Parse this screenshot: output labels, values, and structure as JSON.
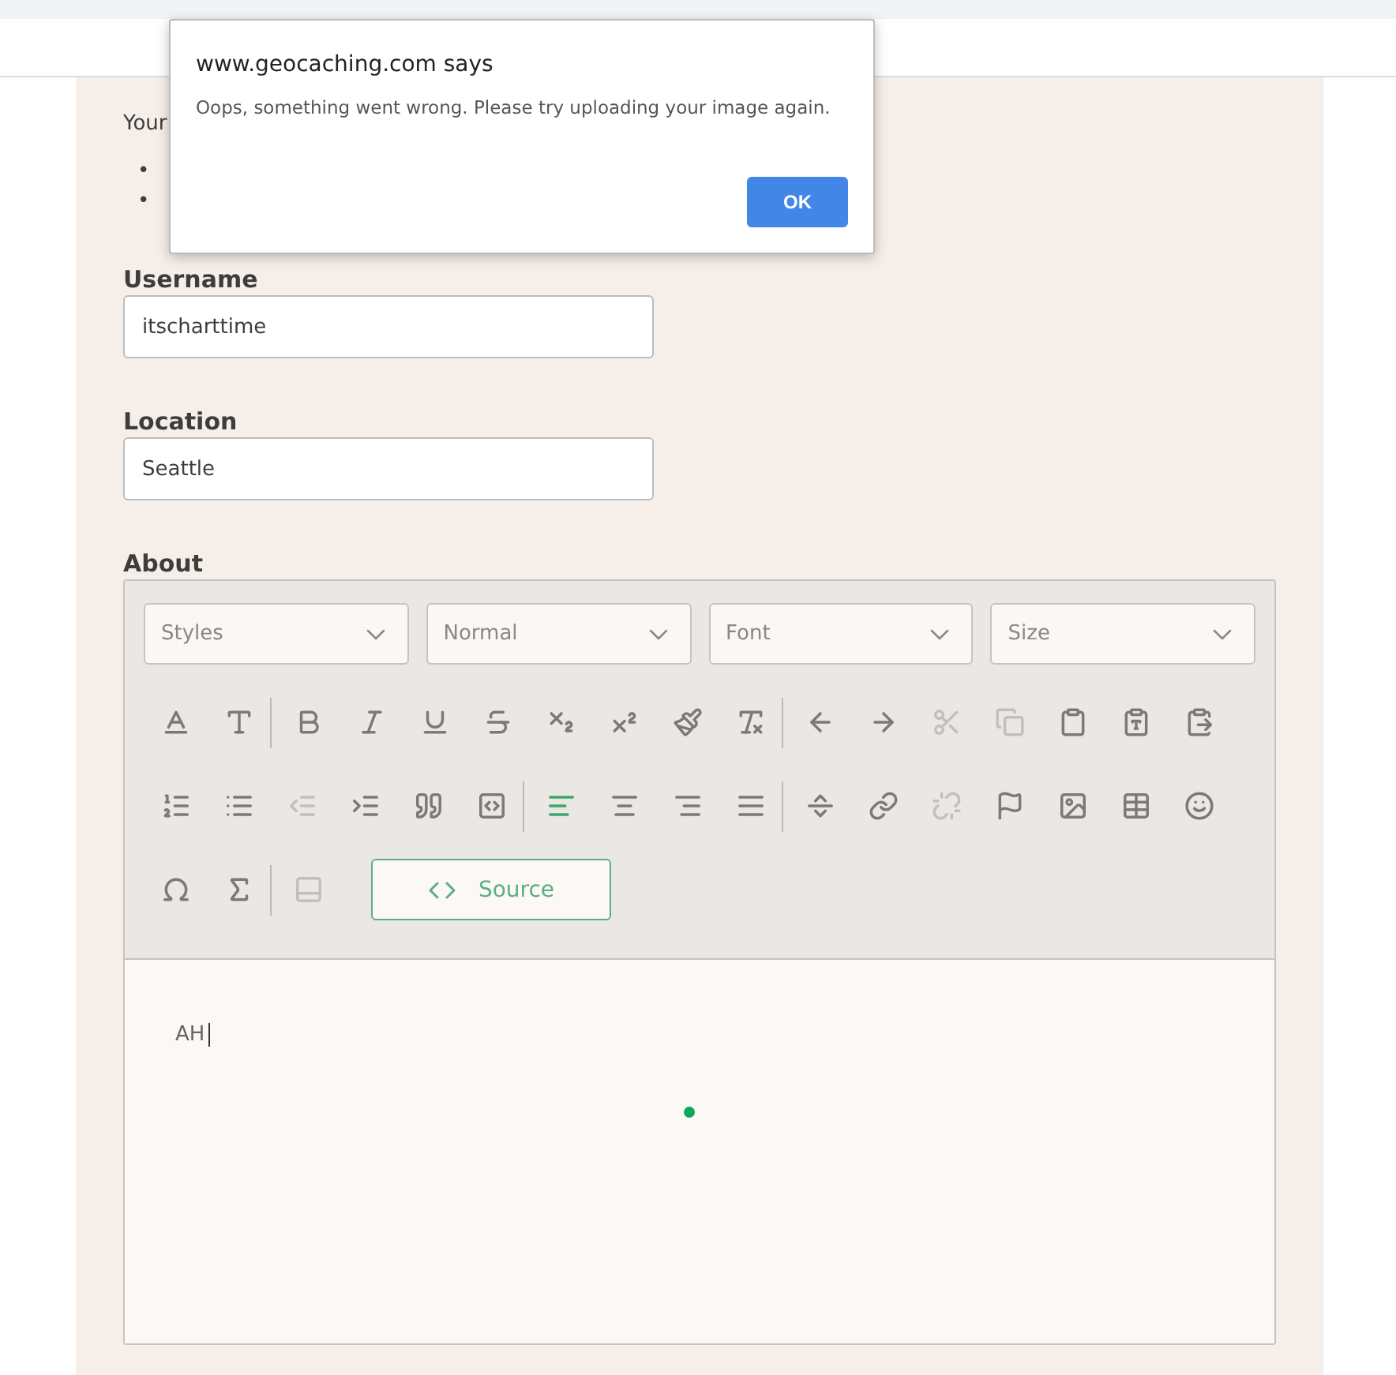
{
  "intro": {
    "text": "Your",
    "bullets": [
      "•",
      "•"
    ]
  },
  "fields": [
    {
      "label": "Username",
      "value": "itscharttime"
    },
    {
      "label": "Location",
      "value": "Seattle"
    }
  ],
  "about": {
    "label": "About",
    "dropdowns": [
      "Styles",
      "Normal",
      "Font",
      "Size"
    ],
    "toolbar_rows": [
      [
        [
          {
            "kind": "text-color",
            "disabled": false,
            "selected": false
          },
          {
            "kind": "bg-color",
            "disabled": false,
            "selected": false
          }
        ],
        [
          {
            "kind": "bold",
            "disabled": false,
            "selected": false
          },
          {
            "kind": "italic",
            "disabled": false,
            "selected": false
          },
          {
            "kind": "underline",
            "disabled": false,
            "selected": false
          },
          {
            "kind": "strike",
            "disabled": false,
            "selected": false
          },
          {
            "kind": "subscript",
            "disabled": false,
            "selected": false
          },
          {
            "kind": "superscript",
            "disabled": false,
            "selected": false
          },
          {
            "kind": "brush",
            "disabled": false,
            "selected": false
          },
          {
            "kind": "remove-format",
            "disabled": false,
            "selected": false
          }
        ],
        [
          {
            "kind": "undo",
            "disabled": false,
            "selected": false
          },
          {
            "kind": "redo",
            "disabled": false,
            "selected": false
          },
          {
            "kind": "cut",
            "disabled": true,
            "selected": false
          },
          {
            "kind": "copy",
            "disabled": true,
            "selected": false
          },
          {
            "kind": "paste",
            "disabled": false,
            "selected": false
          },
          {
            "kind": "paste-text",
            "disabled": false,
            "selected": false
          },
          {
            "kind": "paste-word",
            "disabled": false,
            "selected": false
          }
        ]
      ],
      [
        [
          {
            "kind": "numbered-list",
            "disabled": false,
            "selected": false
          },
          {
            "kind": "bullet-list",
            "disabled": false,
            "selected": false
          },
          {
            "kind": "outdent",
            "disabled": true,
            "selected": false
          },
          {
            "kind": "indent",
            "disabled": false,
            "selected": false
          },
          {
            "kind": "quote",
            "disabled": false,
            "selected": false
          },
          {
            "kind": "div",
            "disabled": false,
            "selected": false
          }
        ],
        [
          {
            "kind": "align-left",
            "disabled": false,
            "selected": true
          },
          {
            "kind": "align-center",
            "disabled": false,
            "selected": false
          },
          {
            "kind": "align-right",
            "disabled": false,
            "selected": false
          },
          {
            "kind": "align-justify",
            "disabled": false,
            "selected": false
          }
        ],
        [
          {
            "kind": "rule",
            "disabled": false,
            "selected": false
          },
          {
            "kind": "link",
            "disabled": false,
            "selected": false
          },
          {
            "kind": "unlink",
            "disabled": true,
            "selected": false
          },
          {
            "kind": "flag",
            "disabled": false,
            "selected": false
          },
          {
            "kind": "image",
            "disabled": false,
            "selected": false
          },
          {
            "kind": "table",
            "disabled": false,
            "selected": false
          },
          {
            "kind": "smiley",
            "disabled": false,
            "selected": false
          }
        ]
      ],
      [
        [
          {
            "kind": "omega",
            "disabled": false,
            "selected": false
          },
          {
            "kind": "sigma",
            "disabled": false,
            "selected": false
          }
        ],
        [
          {
            "kind": "page",
            "disabled": true,
            "selected": false
          }
        ]
      ]
    ],
    "source_button": "Source",
    "content": "AH"
  },
  "dialog": {
    "title": "www.geocaching.com says",
    "message": "Oops, something went wrong. Please try uploading your image again.",
    "button": "OK"
  }
}
